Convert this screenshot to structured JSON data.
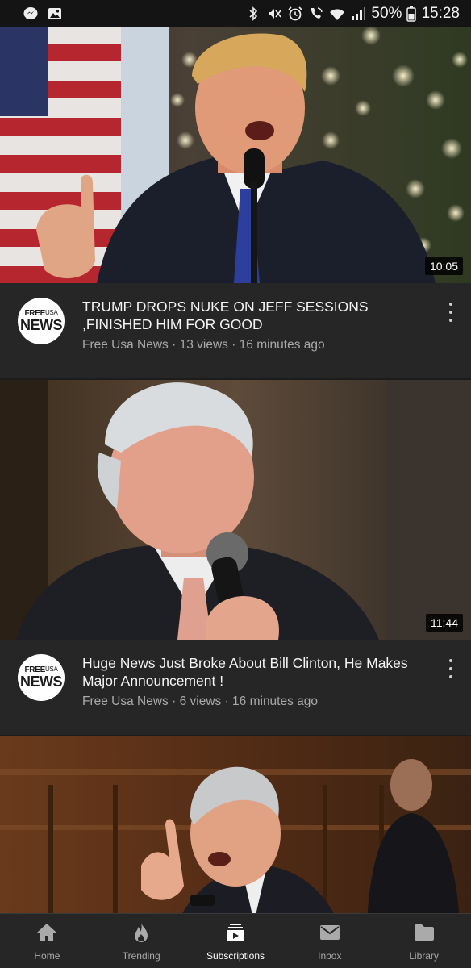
{
  "status_bar": {
    "battery": "50%",
    "time": "15:28"
  },
  "videos": [
    {
      "title": "TRUMP DROPS NUKE ON JEFF SESSIONS ,FINISHED HIM FOR GOOD",
      "channel_line": "Free Usa News · 13 views · 16 minutes ago",
      "duration": "10:05",
      "avatar_top": "FREE",
      "avatar_usa": "USA",
      "avatar_bottom": "NEWS"
    },
    {
      "title": "Huge News Just Broke About Bill Clinton, He Makes Major Announcement !",
      "channel_line": "Free Usa News · 6 views · 16 minutes ago",
      "duration": "11:44",
      "avatar_top": "FREE",
      "avatar_usa": "USA",
      "avatar_bottom": "NEWS"
    }
  ],
  "bottom_nav": [
    {
      "label": "Home",
      "icon": "home-icon"
    },
    {
      "label": "Trending",
      "icon": "flame-icon"
    },
    {
      "label": "Subscriptions",
      "icon": "subscriptions-icon",
      "active": true
    },
    {
      "label": "Inbox",
      "icon": "mail-icon"
    },
    {
      "label": "Library",
      "icon": "folder-icon"
    }
  ],
  "colors": {
    "background": "#262626",
    "status_bar": "#141414",
    "secondary_text": "#aaaaaa"
  }
}
